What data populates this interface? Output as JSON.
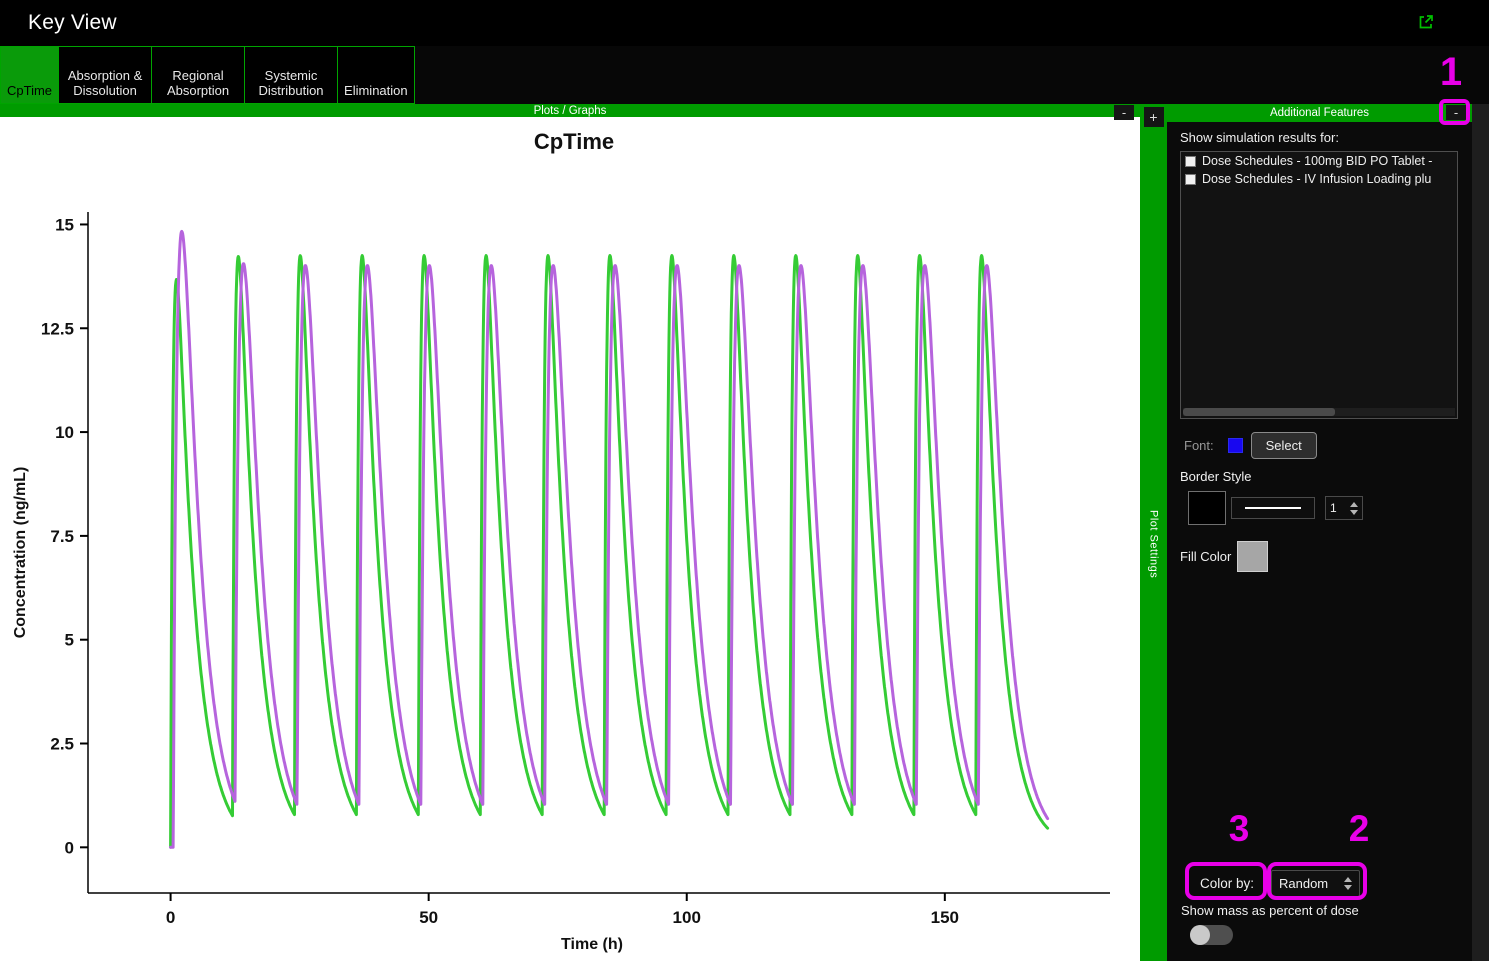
{
  "titlebar": {
    "title": "Key View"
  },
  "tabs": [
    {
      "label": "CpTime",
      "selected": true
    },
    {
      "label": "Absorption & Dissolution",
      "selected": false
    },
    {
      "label": "Regional Absorption",
      "selected": false
    },
    {
      "label": "Systemic Distribution",
      "selected": false
    },
    {
      "label": "Elimination",
      "selected": false
    }
  ],
  "plots_panel": {
    "header": "Plots / Graphs",
    "collapse_label": "-"
  },
  "plot_settings_strip": {
    "expand_label": "+",
    "label": "Plot Settings"
  },
  "additional_features": {
    "header": "Additional Features",
    "collapse_label": "-",
    "show_results_label": "Show simulation results for:",
    "result_items": [
      {
        "label": "Dose Schedules - 100mg BID PO Tablet -",
        "checked": false
      },
      {
        "label": "Dose Schedules - IV Infusion Loading plu",
        "checked": false
      }
    ],
    "font_label": "Font:",
    "font_color": "#1807f0",
    "font_select_label": "Select",
    "border_style_label": "Border Style",
    "border_color": "#000000",
    "border_width_value": "1",
    "fill_color_label": "Fill Color",
    "fill_color": "#a6a6a6",
    "color_by_label": "Color by:",
    "color_by_value": "Random",
    "mass_toggle_label": "Show mass as percent of dose",
    "mass_toggle_on": false
  },
  "annotations": [
    {
      "label": "1"
    },
    {
      "label": "2"
    },
    {
      "label": "3"
    }
  ],
  "annotation_color": "#e800e8",
  "accent_green": "#009b00",
  "chart_data": {
    "type": "line",
    "title": "CpTime",
    "xlabel": "Time (h)",
    "ylabel": "Concentration (ng/mL)",
    "x_ticks": [
      0,
      50,
      100,
      150
    ],
    "y_ticks": [
      0,
      2.5,
      5,
      7.5,
      10,
      12.5,
      15
    ],
    "xlim": [
      -16,
      182
    ],
    "ylim": [
      -1.1,
      15.3
    ],
    "grid": false,
    "legend": "none",
    "dosing": {
      "interval_h": 12,
      "n_doses": 14,
      "t_end_h": 170
    },
    "series": [
      {
        "name": "Dose Schedules - 100mg BID PO Tablet",
        "color": "#35cc35",
        "stroke_width": 3,
        "model": {
          "ka": 2.0,
          "ke": 0.28,
          "scale": 21.9,
          "dose_offset_h": 0,
          "first_dose_factor": 1.0
        },
        "observed": {
          "first_peak": 13.6,
          "steady_state_peak": 14.2,
          "steady_state_trough": 0.7
        }
      },
      {
        "name": "Dose Schedules - IV Infusion Loading plus maintenance",
        "color": "#b664dd",
        "stroke_width": 3,
        "model": {
          "ka": 1.1,
          "ke": 0.28,
          "scale": 28.6,
          "dose_offset_h": 0.5,
          "first_dose_factor": 1.11
        },
        "observed": {
          "first_peak": 14.8,
          "steady_state_peak": 14.2,
          "steady_state_trough": 0.85
        }
      }
    ]
  }
}
